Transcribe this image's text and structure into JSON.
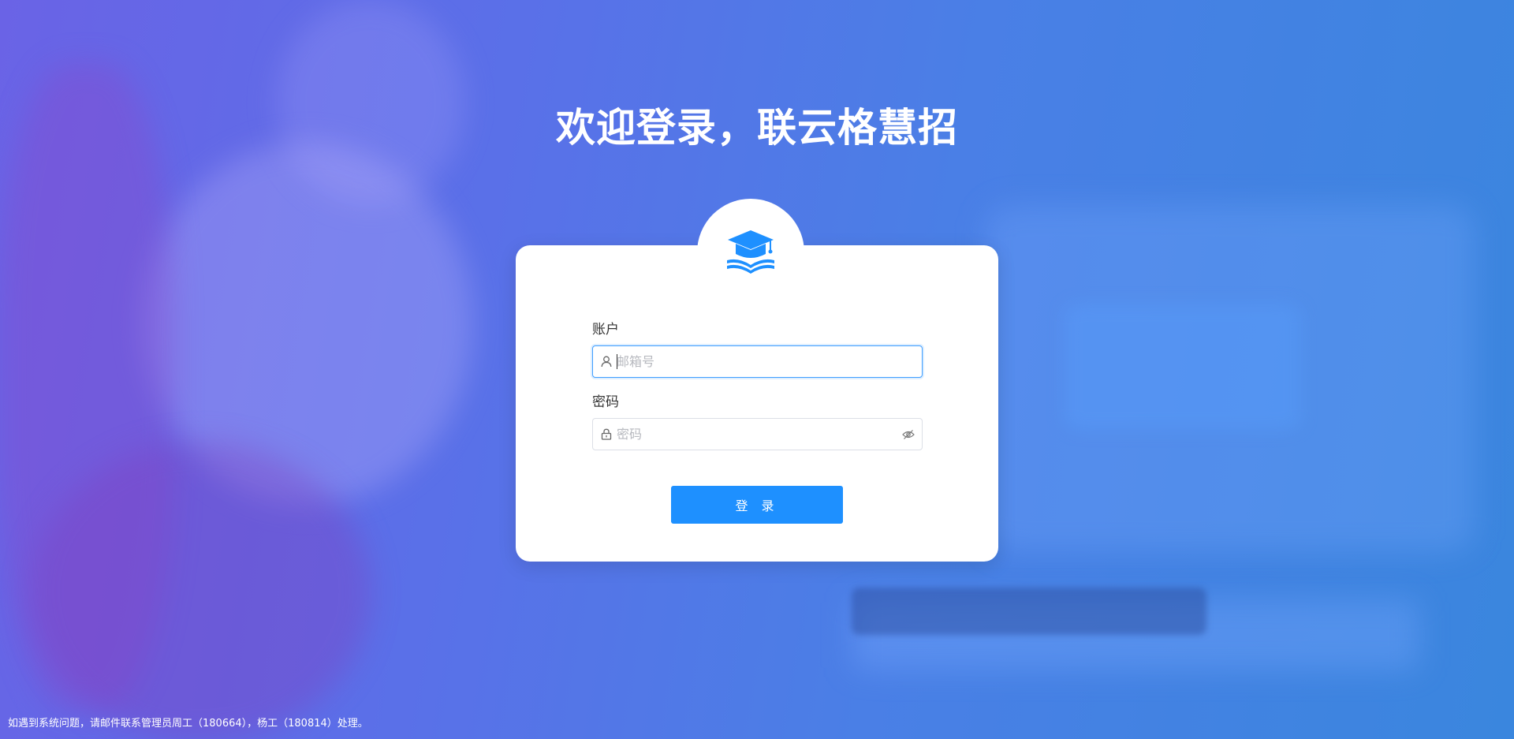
{
  "page": {
    "title": "欢迎登录，联云格慧招"
  },
  "logo": {
    "icon": "graduation-cap-book-icon",
    "color": "#1e90ff"
  },
  "form": {
    "account_label": "账户",
    "account_placeholder": "邮箱号",
    "account_value": "",
    "password_label": "密码",
    "password_placeholder": "密码",
    "password_value": "",
    "login_button": "登 录"
  },
  "icons": {
    "user": "user-icon",
    "lock": "lock-icon",
    "eye_hidden": "eye-hidden-icon"
  },
  "footer": {
    "note": "如遇到系统问题，请邮件联系管理员周工（180664），杨工（180814）处理。"
  },
  "colors": {
    "primary": "#1e90ff",
    "focus_border": "#409eff",
    "card_bg": "#ffffff"
  }
}
